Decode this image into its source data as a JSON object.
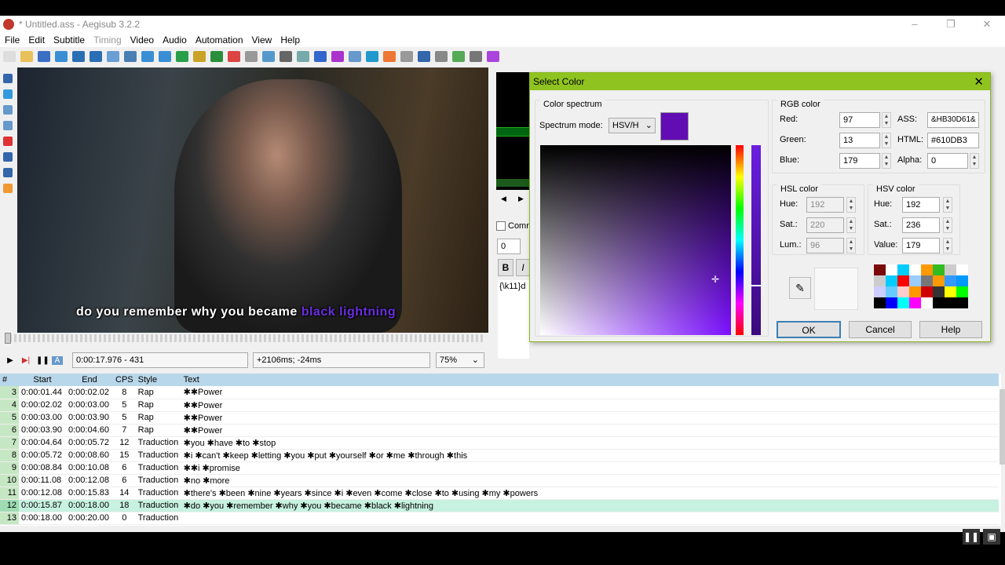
{
  "window": {
    "title": "* Untitled.ass - Aegisub 3.2.2"
  },
  "menu": [
    "File",
    "Edit",
    "Subtitle",
    "Timing",
    "Video",
    "Audio",
    "Automation",
    "View",
    "Help"
  ],
  "video": {
    "subtitle_plain": "do you remember why you became",
    "subtitle_karaoke": "black lightning",
    "time_field": "0:00:17.976 - 431",
    "offset_field": "+2106ms; -24ms",
    "zoom": "75%"
  },
  "edit_panel": {
    "comment_label": "Comm",
    "layer": "0",
    "bold": "B",
    "italic": "I",
    "text": "{\\k11}d"
  },
  "dialog": {
    "title": "Select Color",
    "spectrum_group": "Color spectrum",
    "spectrum_mode_label": "Spectrum mode:",
    "spectrum_mode": "HSV/H",
    "preview_color": "#610DB3",
    "rgb_group": "RGB color",
    "red_label": "Red:",
    "red": "97",
    "green_label": "Green:",
    "green": "13",
    "blue_label": "Blue:",
    "blue": "179",
    "ass_label": "ASS:",
    "ass": "&HB30D61&",
    "html_label": "HTML:",
    "html": "#610DB3",
    "alpha_label": "Alpha:",
    "alpha": "0",
    "hsl_group": "HSL color",
    "hsl_hue_label": "Hue:",
    "hsl_hue": "192",
    "hsl_sat_label": "Sat.:",
    "hsl_sat": "220",
    "hsl_lum_label": "Lum.:",
    "hsl_lum": "96",
    "hsv_group": "HSV color",
    "hsv_hue_label": "Hue:",
    "hsv_hue": "192",
    "hsv_sat_label": "Sat.:",
    "hsv_sat": "236",
    "hsv_val_label": "Value:",
    "hsv_val": "179",
    "ok": "OK",
    "cancel": "Cancel",
    "help": "Help",
    "palette": [
      "#7a0a0a",
      "#fff",
      "#0cf",
      "#fff",
      "#f90",
      "#3b2",
      "#ccc",
      "#fff",
      "#ccc",
      "#0cf",
      "#f00",
      "#9cf",
      "#777",
      "#f90",
      "#39f",
      "#09f",
      "#ccf",
      "#6cf",
      "#fcc",
      "#f90",
      "#c00",
      "#333",
      "#ff0",
      "#0f0",
      "#000",
      "#00f",
      "#0ff",
      "#f0f",
      "#fff",
      "#000",
      "#000",
      "#000"
    ]
  },
  "grid": {
    "headers": [
      "#",
      "Start",
      "End",
      "CPS",
      "Style",
      "Text"
    ],
    "rows": [
      {
        "n": "3",
        "start": "0:00:01.44",
        "end": "0:00:02.02",
        "cps": "8",
        "style": "Rap",
        "text": "✱✱Power"
      },
      {
        "n": "4",
        "start": "0:00:02.02",
        "end": "0:00:03.00",
        "cps": "5",
        "style": "Rap",
        "text": "✱✱Power"
      },
      {
        "n": "5",
        "start": "0:00:03.00",
        "end": "0:00:03.90",
        "cps": "5",
        "style": "Rap",
        "text": "✱✱Power"
      },
      {
        "n": "6",
        "start": "0:00:03.90",
        "end": "0:00:04.60",
        "cps": "7",
        "style": "Rap",
        "text": "✱✱Power"
      },
      {
        "n": "7",
        "start": "0:00:04.64",
        "end": "0:00:05.72",
        "cps": "12",
        "style": "Traduction",
        "text": "✱you ✱have ✱to ✱stop"
      },
      {
        "n": "8",
        "start": "0:00:05.72",
        "end": "0:00:08.60",
        "cps": "15",
        "style": "Traduction",
        "text": "✱i ✱can't ✱keep ✱letting ✱you ✱put ✱yourself ✱or ✱me ✱through ✱this"
      },
      {
        "n": "9",
        "start": "0:00:08.84",
        "end": "0:00:10.08",
        "cps": "6",
        "style": "Traduction",
        "text": "✱✱i ✱promise"
      },
      {
        "n": "10",
        "start": "0:00:11.08",
        "end": "0:00:12.08",
        "cps": "6",
        "style": "Traduction",
        "text": "✱no ✱more"
      },
      {
        "n": "11",
        "start": "0:00:12.08",
        "end": "0:00:15.83",
        "cps": "14",
        "style": "Traduction",
        "text": "✱there's ✱been ✱nine ✱years ✱since ✱i ✱even ✱come ✱close ✱to ✱using ✱my ✱powers"
      },
      {
        "n": "12",
        "start": "0:00:15.87",
        "end": "0:00:18.00",
        "cps": "18",
        "style": "Traduction",
        "text": "✱do ✱you ✱remember ✱why ✱you ✱became ✱black ✱lightning",
        "selected": true
      },
      {
        "n": "13",
        "start": "0:00:18.00",
        "end": "0:00:20.00",
        "cps": "0",
        "style": "Traduction",
        "text": ""
      }
    ]
  }
}
